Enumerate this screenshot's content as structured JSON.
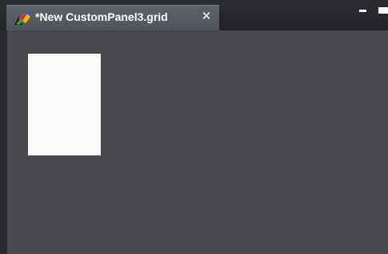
{
  "tab": {
    "title": "*New CustomPanel3.grid",
    "close_glyph": "✕",
    "icon": "grid-editor-icon"
  },
  "window_controls": {
    "minimize_icon": "minimize-icon",
    "maximize_icon": "maximize-icon"
  },
  "colors": {
    "canvas_background": "#48494d",
    "tab_background": "#565b62",
    "panel_background": "#fafafa"
  }
}
